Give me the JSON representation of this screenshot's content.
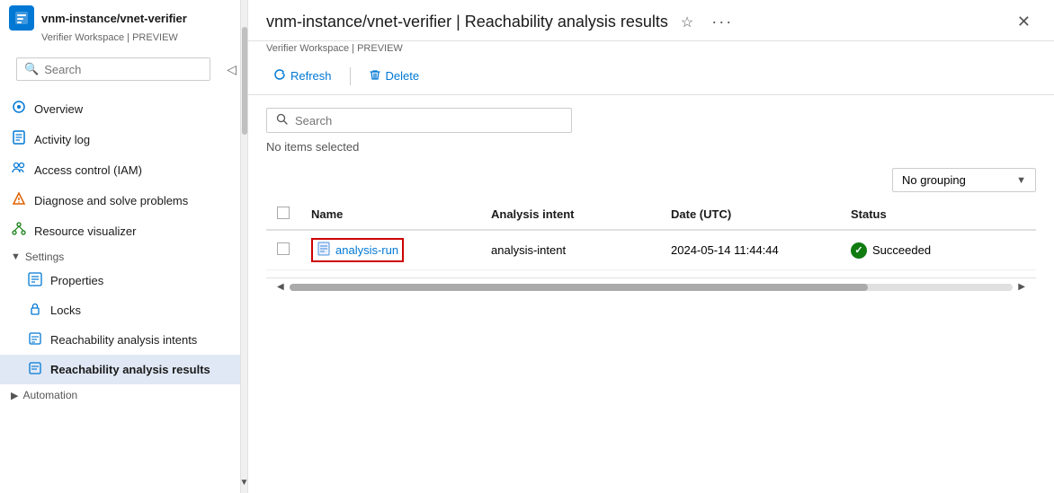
{
  "window": {
    "title": "vnm-instance/vnet-verifier",
    "separator": "|",
    "page": "Reachability analysis results",
    "subtitle": "Verifier Workspace | PREVIEW"
  },
  "sidebar": {
    "search_placeholder": "Search",
    "nav_items": [
      {
        "id": "overview",
        "label": "Overview",
        "icon": "⊙",
        "active": false
      },
      {
        "id": "activity-log",
        "label": "Activity log",
        "icon": "📋",
        "active": false
      },
      {
        "id": "access-control",
        "label": "Access control (IAM)",
        "icon": "👥",
        "active": false
      },
      {
        "id": "diagnose",
        "label": "Diagnose and solve problems",
        "icon": "🔧",
        "active": false
      },
      {
        "id": "resource-visualizer",
        "label": "Resource visualizer",
        "icon": "⚡",
        "active": false
      }
    ],
    "settings_section": "Settings",
    "settings_items": [
      {
        "id": "properties",
        "label": "Properties",
        "icon": "▦",
        "active": false
      },
      {
        "id": "locks",
        "label": "Locks",
        "icon": "🔒",
        "active": false
      },
      {
        "id": "reachability-intents",
        "label": "Reachability analysis intents",
        "icon": "📄",
        "active": false
      },
      {
        "id": "reachability-results",
        "label": "Reachability analysis results",
        "icon": "🗒",
        "active": true
      }
    ],
    "automation_section": "Automation"
  },
  "toolbar": {
    "refresh_label": "Refresh",
    "delete_label": "Delete"
  },
  "content": {
    "search_placeholder": "Search",
    "no_items_label": "No items selected",
    "grouping_label": "No grouping",
    "table": {
      "columns": [
        "Name",
        "Analysis intent",
        "Date (UTC)",
        "Status"
      ],
      "rows": [
        {
          "name": "analysis-run",
          "intent": "analysis-intent",
          "date": "2024-05-14 11:44:44",
          "status": "Succeeded"
        }
      ]
    }
  }
}
